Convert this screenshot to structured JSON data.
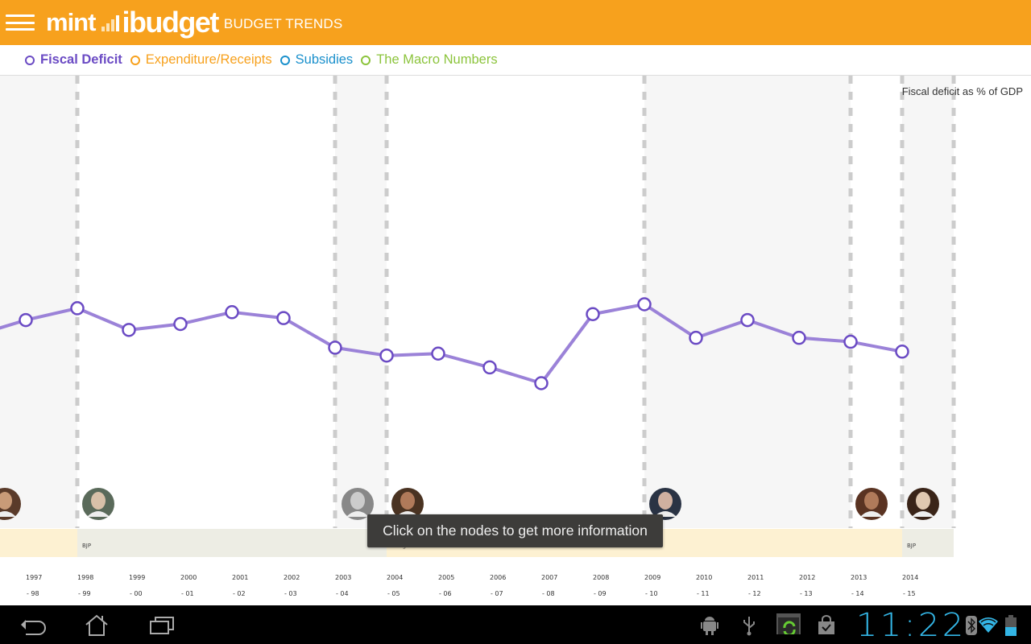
{
  "header": {
    "brand_left": "mint",
    "brand_right": "ibudget",
    "title": "BUDGET TRENDS"
  },
  "tabs": [
    {
      "label": "Fiscal Deficit",
      "color": "#6b4bc4",
      "active": true
    },
    {
      "label": "Expenditure/Receipts",
      "color": "#f7a11d",
      "active": false
    },
    {
      "label": "Subsidies",
      "color": "#1a90cc",
      "active": false
    },
    {
      "label": "The Macro Numbers",
      "color": "#8cc43c",
      "active": false
    }
  ],
  "toast": "Click on the nodes to get more information",
  "status_bar": {
    "time": "11:22",
    "icons": [
      "android-debug-icon",
      "usb-icon",
      "sync-app-icon",
      "store-update-icon",
      "bluetooth-icon",
      "wifi-icon",
      "battery-icon"
    ]
  },
  "nav": [
    "back-icon",
    "home-icon",
    "recent-apps-icon"
  ],
  "chart_data": {
    "type": "line",
    "title": "Fiscal deficit as % of GDP",
    "ylabel": "Fiscal deficit as % of GDP",
    "xlabel": "",
    "line_color": "#9b82d8",
    "node_color": "#6b4bc4",
    "categories": [
      {
        "top": "1997",
        "bottom": "- 98"
      },
      {
        "top": "1998",
        "bottom": "- 99"
      },
      {
        "top": "1999",
        "bottom": "- 00"
      },
      {
        "top": "2000",
        "bottom": "- 01"
      },
      {
        "top": "2001",
        "bottom": "- 02"
      },
      {
        "top": "2002",
        "bottom": "- 03"
      },
      {
        "top": "2003",
        "bottom": "- 04"
      },
      {
        "top": "2004",
        "bottom": "- 05"
      },
      {
        "top": "2005",
        "bottom": "- 06"
      },
      {
        "top": "2006",
        "bottom": "- 07"
      },
      {
        "top": "2007",
        "bottom": "- 08"
      },
      {
        "top": "2008",
        "bottom": "- 09"
      },
      {
        "top": "2009",
        "bottom": "- 10"
      },
      {
        "top": "2010",
        "bottom": "- 11"
      },
      {
        "top": "2011",
        "bottom": "- 12"
      },
      {
        "top": "2012",
        "bottom": "- 13"
      },
      {
        "top": "2013",
        "bottom": "- 14"
      },
      {
        "top": "2014",
        "bottom": "- 15"
      }
    ],
    "series": [
      {
        "name": "Fiscal Deficit",
        "previous_value": 4.9,
        "values": [
          5.7,
          6.3,
          5.2,
          5.5,
          6.1,
          5.8,
          4.3,
          3.9,
          4.0,
          3.3,
          2.5,
          6.0,
          6.5,
          4.8,
          5.7,
          4.8,
          4.6,
          4.1
        ]
      }
    ],
    "ylim": [
      0,
      14
    ],
    "finance_minister_terms": [
      {
        "start_index": -1,
        "end_index": 0,
        "shaded": true,
        "avatar": "minister-avatar-1"
      },
      {
        "start_index": 1,
        "end_index": 5,
        "shaded": false,
        "avatar": "minister-avatar-2"
      },
      {
        "start_index": 6,
        "end_index": 6,
        "shaded": true,
        "avatar": "minister-avatar-3"
      },
      {
        "start_index": 7,
        "end_index": 11,
        "shaded": false,
        "avatar": "minister-avatar-4"
      },
      {
        "start_index": 12,
        "end_index": 15,
        "shaded": true,
        "avatar": "minister-avatar-5"
      },
      {
        "start_index": 16,
        "end_index": 16,
        "shaded": false,
        "avatar": "minister-avatar-6"
      },
      {
        "start_index": 17,
        "end_index": 17,
        "shaded": true,
        "avatar": "minister-avatar-7"
      }
    ],
    "party_terms": [
      {
        "label": "",
        "start_index": -1,
        "end_index": 0,
        "color": "#fdf1d2"
      },
      {
        "label": "BJP",
        "start_index": 1,
        "end_index": 6,
        "color": "#ededE4"
      },
      {
        "label": "Congress",
        "start_index": 7,
        "end_index": 16,
        "color": "#fdf1d2"
      },
      {
        "label": "BJP",
        "start_index": 17,
        "end_index": 17,
        "color": "#ededE4"
      }
    ]
  }
}
